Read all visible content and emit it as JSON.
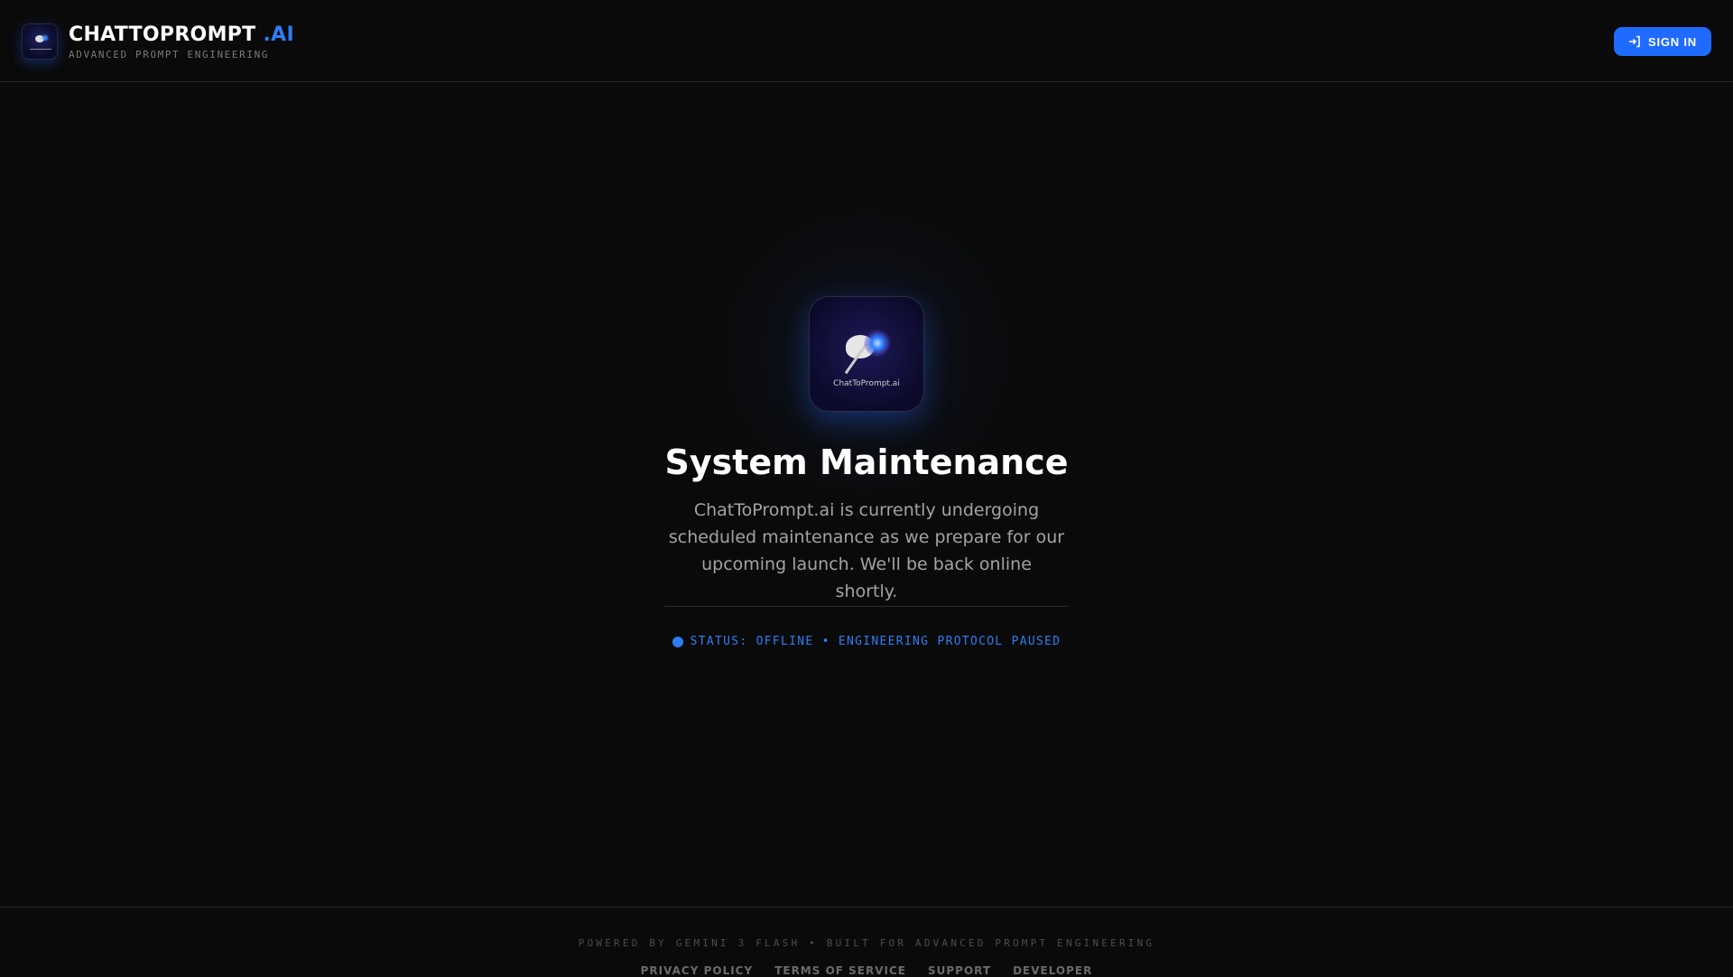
{
  "header": {
    "brand": "CHATTOPROMPT",
    "brand_suffix": ".AI",
    "tagline": "ADVANCED PROMPT ENGINEERING",
    "sign_in": "SIGN IN"
  },
  "main": {
    "logo_caption": "ChatToPrompt.ai",
    "title": "System Maintenance",
    "description": "ChatToPrompt.ai is currently undergoing scheduled maintenance as we prepare for our upcoming launch. We'll be back online shortly.",
    "status": "STATUS: OFFLINE • ENGINEERING PROTOCOL PAUSED"
  },
  "footer": {
    "powered": "POWERED BY GEMINI 3 FLASH • BUILT FOR ADVANCED PROMPT ENGINEERING",
    "links": [
      "PRIVACY POLICY",
      "TERMS OF SERVICE",
      "SUPPORT",
      "DEVELOPER"
    ]
  },
  "colors": {
    "accent": "#2d7df6",
    "button": "#1f6bff",
    "background": "#0a0a0a"
  }
}
